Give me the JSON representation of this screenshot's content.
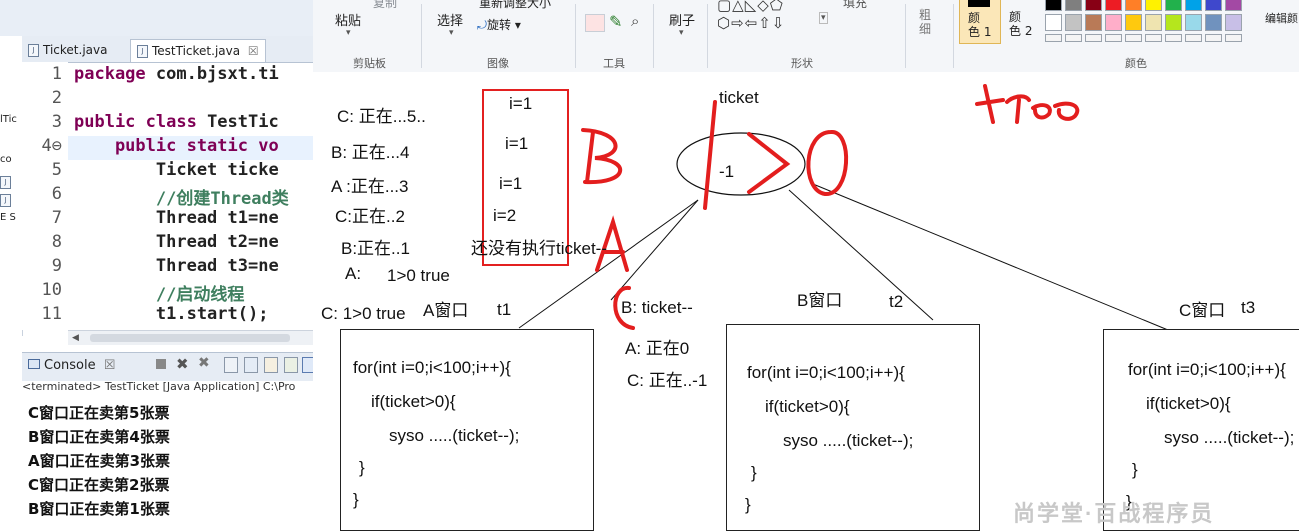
{
  "ide": {
    "package_items": [
      "lTic",
      "co",
      "E S"
    ],
    "tabs": [
      {
        "label": "Ticket.java"
      },
      {
        "label": "TestTicket.java",
        "close": "☒"
      }
    ],
    "line_numbers": [
      "1",
      "2",
      "3",
      "4⊖",
      "5",
      "6",
      "7",
      "8",
      "9",
      "10",
      "11"
    ],
    "code_lines": [
      {
        "kw": "package",
        "rest": " com.bjsxt.ti"
      },
      {
        "kw": "",
        "rest": ""
      },
      {
        "kw": "public class",
        "rest": " TestTic"
      },
      {
        "kw": "    public static vo",
        "rest": ""
      },
      {
        "kw": "",
        "rest": "        Ticket ticke"
      },
      {
        "kw": "",
        "rest": "        //创建Thread类"
      },
      {
        "kw": "",
        "rest": "        Thread t1=ne"
      },
      {
        "kw": "",
        "rest": "        Thread t2=ne"
      },
      {
        "kw": "",
        "rest": "        Thread t3=ne"
      },
      {
        "kw": "",
        "rest": "        //启动线程"
      },
      {
        "kw": "",
        "rest": "        t1.start();"
      }
    ],
    "console_title": "Console",
    "console_close": "☒",
    "console_status": "<terminated> TestTicket [Java Application] C:\\Pro",
    "console_output": [
      "C窗口正在卖第5张票",
      "B窗口正在卖第4张票",
      "A窗口正在卖第3张票",
      "C窗口正在卖第2张票",
      "B窗口正在卖第1张票"
    ]
  },
  "ribbon": {
    "paste": "粘贴",
    "copy": "复制",
    "select": "选择",
    "resize": "重新调整大小",
    "rotate": "旋转",
    "brush": "刷子",
    "fill": "填充",
    "size": "粗\n细",
    "color1": "颜\n色 1",
    "color2": "颜\n色 2",
    "edit_colors": "编辑颜",
    "groups": [
      "剪贴板",
      "图像",
      "工具",
      "形状",
      "颜色"
    ],
    "palette_row1": [
      "#000000",
      "#7f7f7f",
      "#880015",
      "#ed1c24",
      "#ff7f27",
      "#fff200",
      "#22b14c",
      "#00a2e8",
      "#3f48cc",
      "#a349a4",
      "#ffffff",
      "#c3c3c3",
      "#b97a57",
      "#ffaec9",
      "#ffc90e",
      "#efe4b0",
      "#b5e61d",
      "#99d9ea",
      "#7092be",
      "#c8bfe7"
    ]
  },
  "canvas": {
    "ticket_label": "ticket",
    "ellipse_value": "-1",
    "left_notes": [
      "C: 正在...5..",
      "B: 正在...4",
      "A :正在...3",
      "C:正在..2",
      "B:正在..1",
      "A:",
      "C:  1>0  true"
    ],
    "a_note": "1>0 true",
    "red_box_values": [
      "i=1",
      "i=1",
      "i=1",
      "i=2"
    ],
    "not_executed": "还没有执行ticket--",
    "middle_notes": [
      "B: ticket--",
      "A:   正在0",
      "C: 正在..-1"
    ],
    "windows": [
      {
        "name": "A窗口",
        "thread": "t1"
      },
      {
        "name": "B窗口",
        "thread": "t2"
      },
      {
        "name": "C窗口",
        "thread": "t3"
      }
    ],
    "code_box": [
      "for(int i=0;i<100;i++){",
      "if(ticket>0){",
      "syso .....(ticket--);",
      "}",
      "}"
    ],
    "handwriting": [
      "B",
      "A",
      "C",
      "1 > 0",
      "true"
    ],
    "watermark": "尚学堂·百战程序员"
  }
}
